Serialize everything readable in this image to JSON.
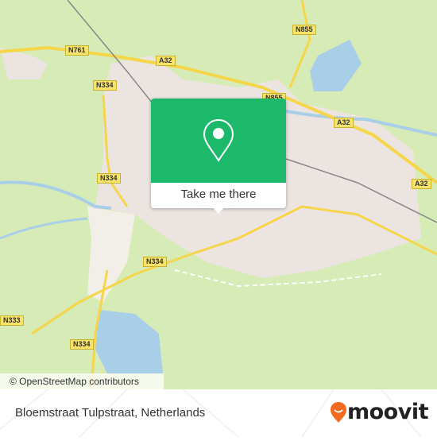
{
  "map": {
    "road_labels": [
      "N761",
      "A32",
      "N855",
      "N855",
      "A32",
      "A32",
      "N334",
      "N334",
      "N334",
      "N333",
      "N334"
    ],
    "attribution": "© OpenStreetMap contributors",
    "colors": {
      "land": "#d7ebb6",
      "urban": "#ece4e0",
      "water": "#a9cfe8",
      "road": "#f5d64a"
    }
  },
  "popup": {
    "icon": "map-pin-icon",
    "button_label": "Take me there",
    "color": "#1db96b"
  },
  "footer": {
    "address": "Bloemstraat Tulpstraat, Netherlands",
    "brand": "moovit",
    "brand_color": "#f26b21"
  }
}
